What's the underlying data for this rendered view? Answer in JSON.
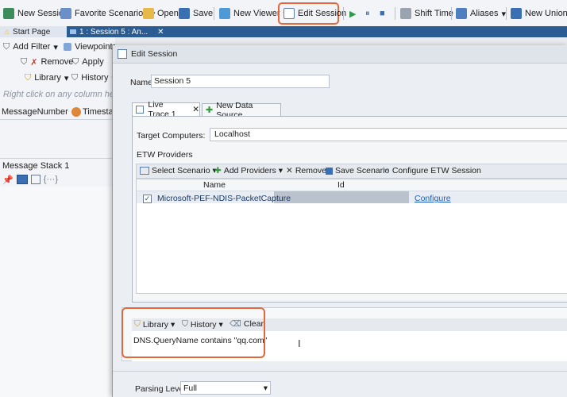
{
  "toolbar": {
    "new_session": "New Session",
    "favorite_scenarios": "Favorite Scenarios",
    "open": "Open",
    "save": "Save",
    "new_viewer": "New Viewer",
    "edit_session": "Edit Session",
    "shift_time": "Shift Time",
    "aliases": "Aliases",
    "new_union": "New Union"
  },
  "tabs": {
    "start_page": "Start Page",
    "session_tab": "1 : Session 5 : An..."
  },
  "left_pane": {
    "add_filter": "Add Filter",
    "viewpoints": "Viewpoints",
    "remove": "Remove",
    "apply": "Apply",
    "library": "Library",
    "history": "History",
    "hint": "Right click on any column head",
    "col_message_number": "MessageNumber",
    "col_timestamp": "Timestam",
    "message_stack": "Message Stack 1"
  },
  "dialog": {
    "title": "Edit Session",
    "name_label": "Name:",
    "name_value": "Session 5",
    "tab_live_trace": "Live Trace 1",
    "tab_new_source": "New Data Source",
    "target_label": "Target Computers:",
    "target_value": "Localhost",
    "etw_label": "ETW Providers",
    "etw_toolbar": {
      "select_scenario": "Select Scenario",
      "add_providers": "Add Providers",
      "remove": "Remove",
      "save_scenario": "Save Scenario",
      "configure": "Configure ETW Session"
    },
    "grid_headers": [
      "Name",
      "Id"
    ],
    "provider_row": {
      "name": "Microsoft-PEF-NDIS-PacketCapture",
      "configure": "Configure"
    },
    "filter_toolbar": {
      "library": "Library",
      "history": "History",
      "clear": "Clear"
    },
    "filter_text": "DNS.QueryName contains \"qq.com\"",
    "parsing_label": "Parsing Level:",
    "parsing_value": "Full"
  },
  "colors": {
    "highlight": "#e2683b",
    "tabstrip": "#2a5c93",
    "link": "#1f5fbf"
  }
}
